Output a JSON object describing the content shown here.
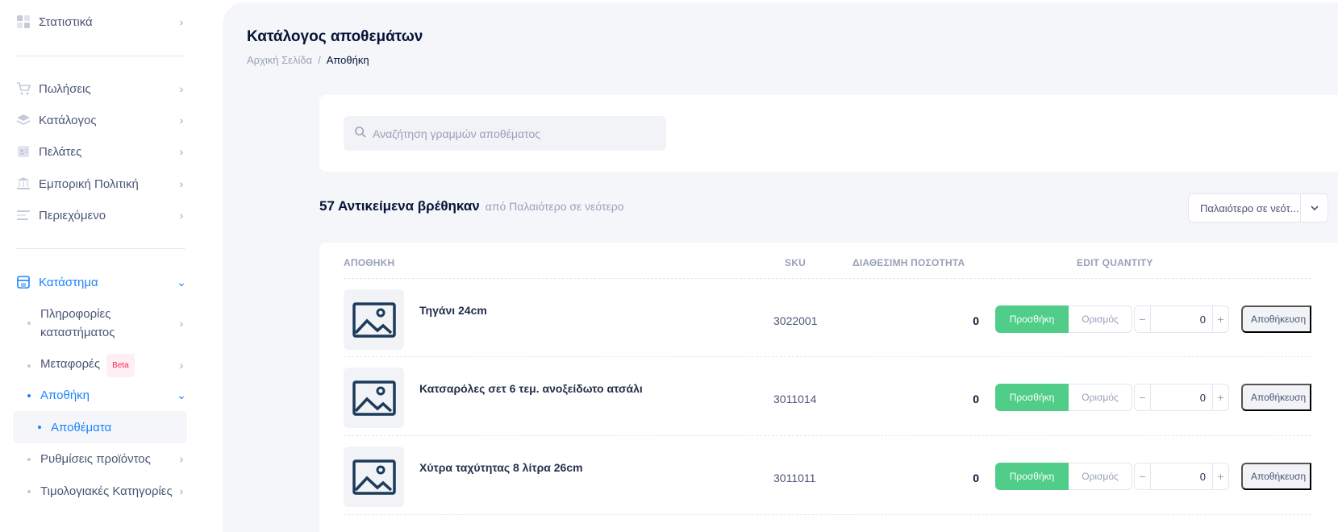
{
  "sidebar": {
    "stats": "Στατιστικά",
    "sales": "Πωλήσεις",
    "catalog": "Κατάλογος",
    "customers": "Πελάτες",
    "commercial_policy": "Εμπορική Πολιτική",
    "content": "Περιεχόμενο",
    "store": "Κατάστημα",
    "store_info": "Πληροφορίες καταστήματος",
    "transfers": "Μεταφορές",
    "beta_badge": "Beta",
    "warehouse": "Αποθήκη",
    "stocks": "Αποθέματα",
    "product_settings": "Ρυθμίσεις προϊόντος",
    "price_categories": "Τιμολογιακές Κατηγορίες"
  },
  "header": {
    "title": "Κατάλογος αποθεμάτων",
    "breadcrumb_home": "Αρχική Σελίδα",
    "breadcrumb_sep": "/",
    "breadcrumb_current": "Αποθήκη"
  },
  "search": {
    "placeholder": "Αναζήτηση γραμμών αποθέματος"
  },
  "results": {
    "count_label": "57 Αντικείμενα βρέθηκαν",
    "sort_label": "από Παλαιότερο σε νεότερο",
    "sort_select": "Παλαιότερο σε νεότ..."
  },
  "table": {
    "headers": {
      "warehouse": "ΑΠΟΘΗΚΗ",
      "sku": "SKU",
      "available_qty": "ΔΙΑΘΕΣΙΜΗ ΠΟΣΟΤΗΤΑ",
      "edit_qty": "EDIT QUANTITY"
    },
    "add_label": "Προσθήκη",
    "set_label": "Ορισμός",
    "save_label": "Αποθήκευση",
    "minus": "−",
    "plus": "+",
    "rows": [
      {
        "name": "Τηγάνι 24cm",
        "sku": "3022001",
        "qty": "0",
        "edit": "0"
      },
      {
        "name": "Κατσαρόλες σετ 6 τεμ. ανοξείδωτο ατσάλι",
        "sku": "3011014",
        "qty": "0",
        "edit": "0"
      },
      {
        "name": "Χύτρα ταχύτητας 8 λίτρα 26cm",
        "sku": "3011011",
        "qty": "0",
        "edit": "0"
      }
    ]
  },
  "colors": {
    "accent": "#1b84ff",
    "success": "#50cd89",
    "badge": "#f8285a"
  }
}
